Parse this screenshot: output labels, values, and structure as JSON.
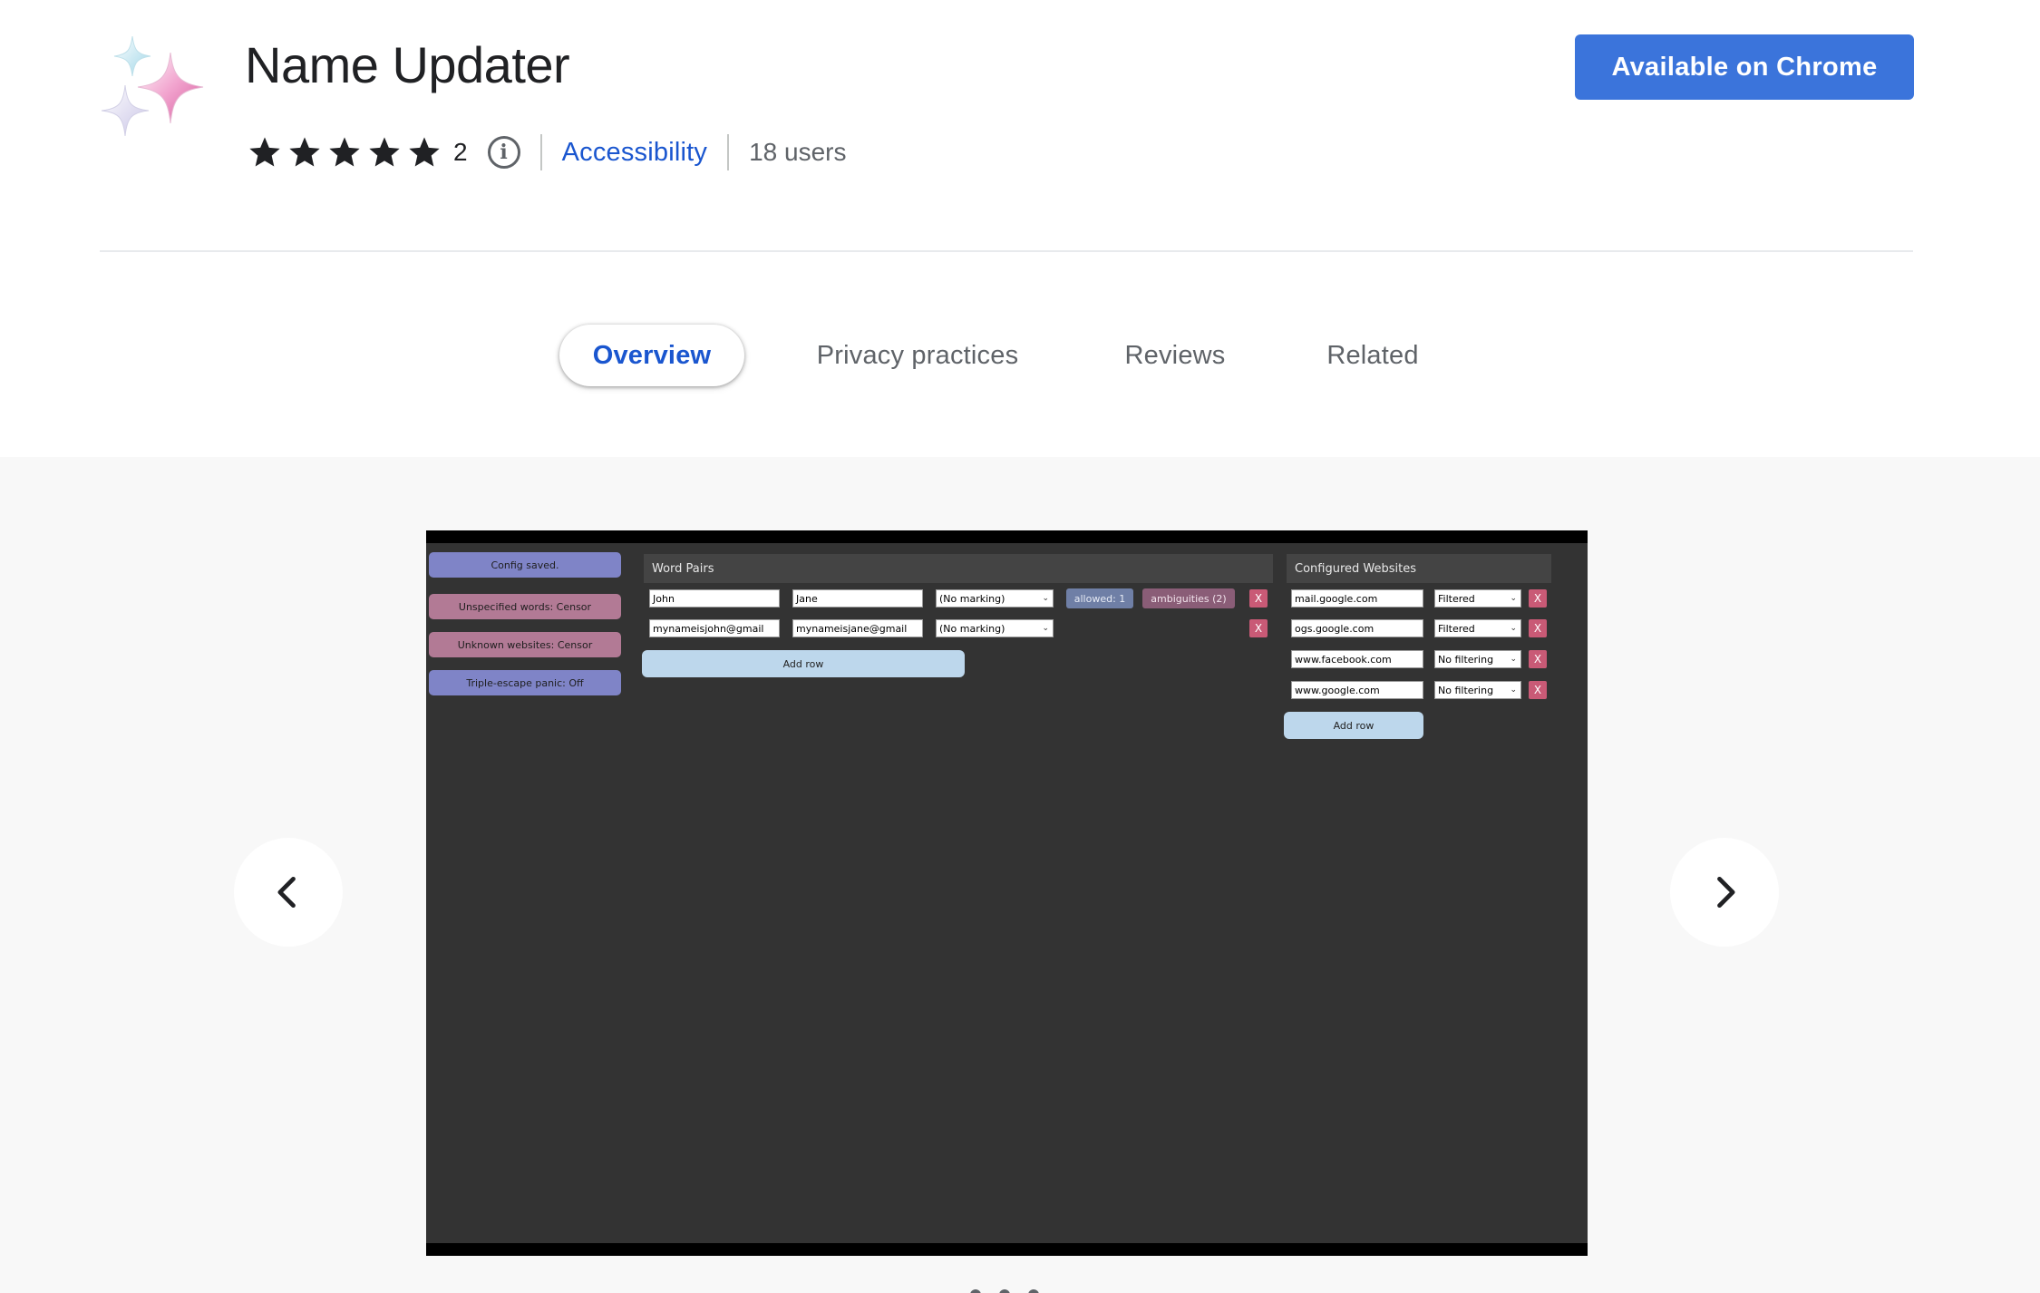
{
  "header": {
    "title": "Name Updater",
    "rating_count": "2",
    "rating_stars": 5,
    "info_icon_glyph": "i",
    "category": "Accessibility",
    "users": "18 users",
    "install_button": "Available on Chrome",
    "icon": "sparkles-icon"
  },
  "tabs": [
    {
      "label": "Overview",
      "active": true
    },
    {
      "label": "Privacy practices",
      "active": false
    },
    {
      "label": "Reviews",
      "active": false
    },
    {
      "label": "Related",
      "active": false
    }
  ],
  "gallery": {
    "prev_icon": "chevron-left-icon",
    "next_icon": "chevron-right-icon",
    "screenshot": {
      "sidebar_buttons": [
        "Config saved.",
        "Unspecified words: Censor",
        "Unknown websites: Censor",
        "Triple-escape panic: Off"
      ],
      "word_pairs": {
        "title": "Word Pairs",
        "rows": [
          {
            "from": "John",
            "to": "Jane",
            "marking": "(No marking)",
            "allowed": "allowed: 1",
            "ambiguities": "ambiguities (2)",
            "remove": "X"
          },
          {
            "from": "mynameisjohn@gmail",
            "to": "mynameisjane@gmail",
            "marking": "(No marking)",
            "remove": "X"
          }
        ],
        "add_row": "Add row"
      },
      "websites": {
        "title": "Configured Websites",
        "rows": [
          {
            "site": "mail.google.com",
            "mode": "Filtered",
            "remove": "X"
          },
          {
            "site": "ogs.google.com",
            "mode": "Filtered",
            "remove": "X"
          },
          {
            "site": "www.facebook.com",
            "mode": "No filtering",
            "remove": "X"
          },
          {
            "site": "www.google.com",
            "mode": "No filtering",
            "remove": "X"
          }
        ],
        "add_row": "Add row"
      }
    }
  },
  "colors": {
    "accent": "#1a56cf",
    "install_button": "#3b74db",
    "gallery_bg": "#f8f8f8"
  }
}
